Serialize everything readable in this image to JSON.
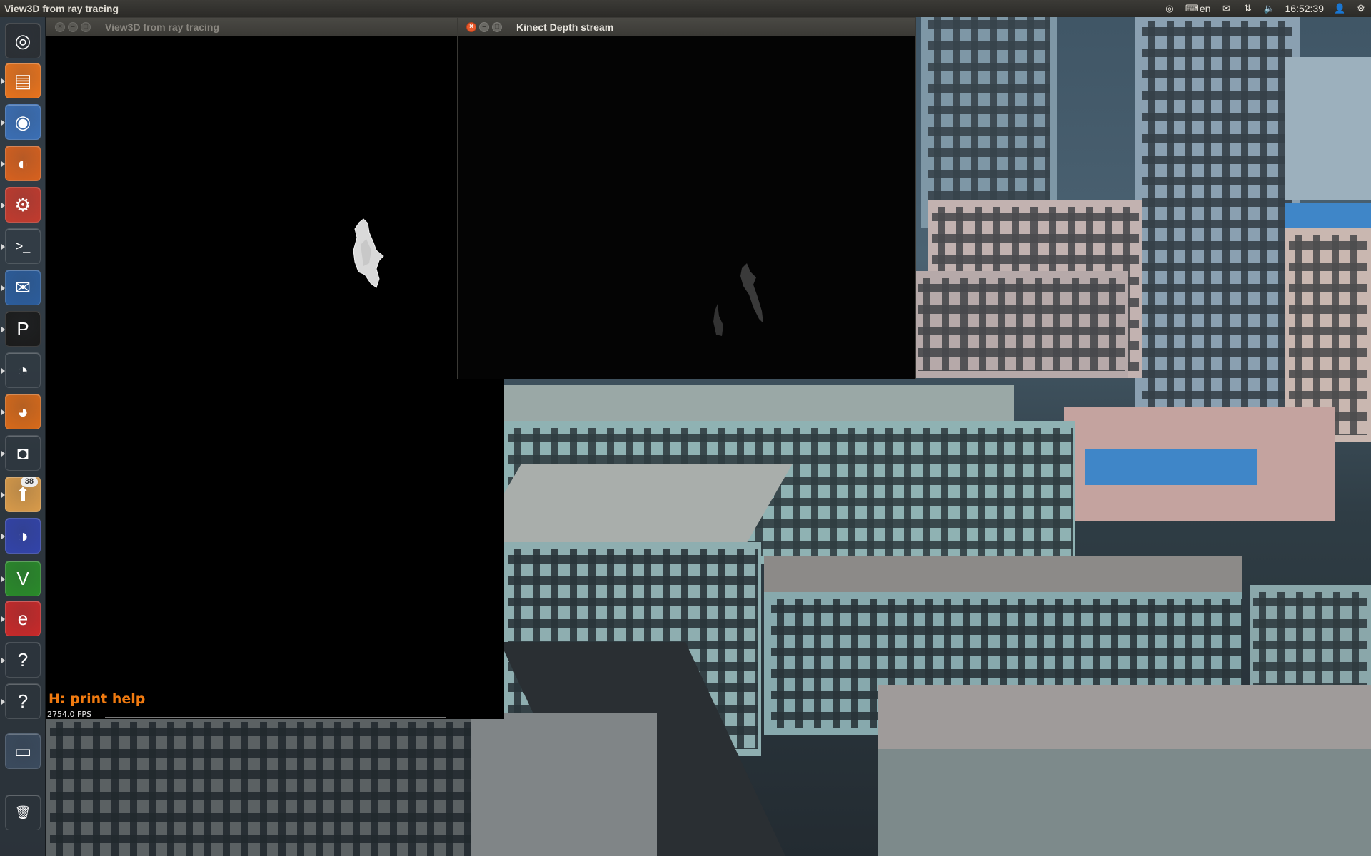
{
  "top_panel": {
    "active_app_title": "View3D from ray tracing",
    "keyboard_layout": "en",
    "clock": "16:52:39"
  },
  "launcher": {
    "items": [
      {
        "name": "dash-home-icon",
        "glyph": "◎"
      },
      {
        "name": "files-icon",
        "glyph": "▤"
      },
      {
        "name": "chromium-icon",
        "glyph": "◉"
      },
      {
        "name": "firefox-icon",
        "glyph": "◐"
      },
      {
        "name": "system-settings-icon",
        "glyph": "⚙"
      },
      {
        "name": "terminal-icon",
        "glyph": ">_"
      },
      {
        "name": "thunderbird-icon",
        "glyph": "✉"
      },
      {
        "name": "pycharm-icon",
        "glyph": "P"
      },
      {
        "name": "eye-of-gnome-icon",
        "glyph": "◔"
      },
      {
        "name": "blender-icon",
        "glyph": "◕"
      },
      {
        "name": "camera-app-icon",
        "glyph": "◘"
      },
      {
        "name": "update-manager-icon",
        "glyph": "⬆",
        "badge": "38"
      },
      {
        "name": "eclipse-icon",
        "glyph": "◑"
      },
      {
        "name": "vim-icon",
        "glyph": "V"
      },
      {
        "name": "evince-icon",
        "glyph": "e"
      },
      {
        "name": "unknown-app-icon",
        "glyph": "?"
      },
      {
        "name": "unknown-app-icon",
        "glyph": "?"
      },
      {
        "name": "workspace-switcher-icon",
        "glyph": "▭"
      },
      {
        "name": "trash-icon",
        "glyph": "🗑"
      }
    ]
  },
  "windows": {
    "view3d": {
      "title": "View3D from ray tracing"
    },
    "kinect": {
      "title": "Kinect Depth stream"
    },
    "gl_window": {
      "help_text": "H: print help",
      "fps_text": "2754.0 FPS"
    }
  }
}
